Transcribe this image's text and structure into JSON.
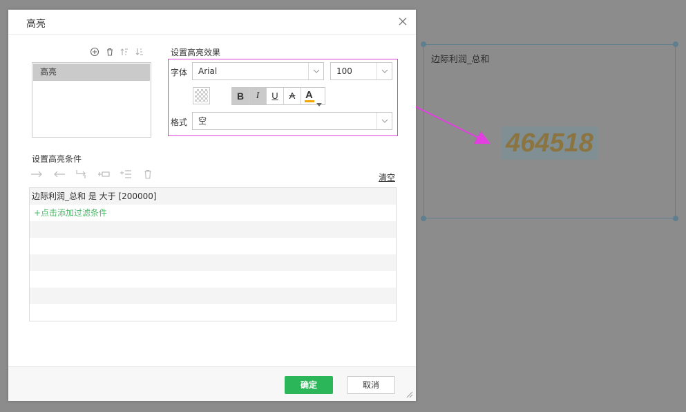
{
  "dialog": {
    "title": "高亮",
    "ok_label": "确定",
    "cancel_label": "取消"
  },
  "highlight_list": {
    "items": [
      {
        "label": "高亮",
        "selected": true
      }
    ]
  },
  "effect": {
    "section_label": "设置高亮效果",
    "font_label": "字体",
    "font_value": "Arial",
    "size_value": "100",
    "format_label": "格式",
    "format_value": "空",
    "bold_label": "B",
    "italic_label": "I",
    "underline_label": "U",
    "strike_label": "A",
    "fontcolor_label": "A",
    "fontcolor": "#f0a500",
    "border_color": "#dd3adb"
  },
  "conditions": {
    "section_label": "设置高亮条件",
    "clear_label": "清空",
    "rows": [
      "边际利润_总和 是 大于 [200000]"
    ],
    "add_label": "+点击添加过滤条件"
  },
  "widget": {
    "title": "边际利润_总和",
    "value": "464518"
  },
  "colors": {
    "accent": "#2bb65a",
    "link": "#4cb86a",
    "annotation": "#dd3adb"
  }
}
